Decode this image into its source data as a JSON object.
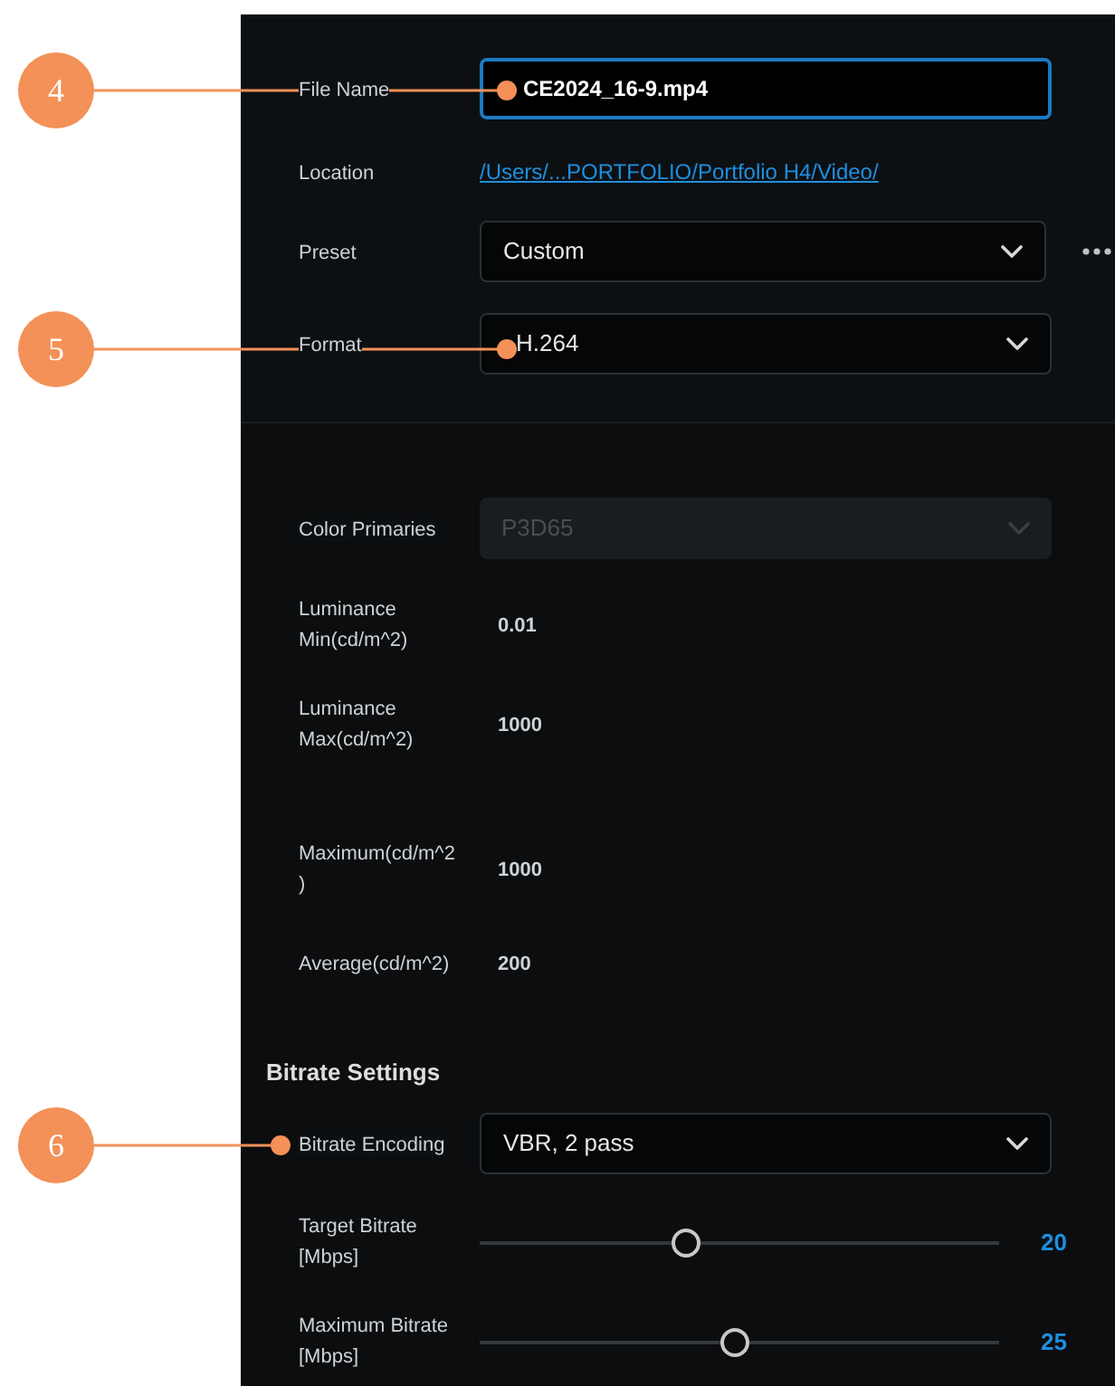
{
  "callouts": [
    {
      "number": "4"
    },
    {
      "number": "5"
    },
    {
      "number": "6"
    }
  ],
  "output": {
    "file_name": {
      "label": "File Name",
      "value": "CE2024_16-9.mp4",
      "focused": true
    },
    "location": {
      "label": "Location",
      "value": "/Users/...PORTFOLIO/Portfolio H4/Video/"
    },
    "preset": {
      "label": "Preset",
      "value": "Custom"
    },
    "format": {
      "label": "Format",
      "value": "H.264"
    }
  },
  "hdr": {
    "color_primaries": {
      "label": "Color Primaries",
      "value": "P3D65",
      "disabled": true
    },
    "rows": [
      {
        "label": "Luminance Min(cd/m^2)",
        "value": "0.01"
      },
      {
        "label": "Luminance Max(cd/m^2)",
        "value": "1000"
      },
      {
        "label": "Maximum(cd/m^2)",
        "value": "1000"
      },
      {
        "label": "Average(cd/m^2)",
        "value": "200"
      }
    ]
  },
  "bitrate": {
    "title": "Bitrate Settings",
    "encoding": {
      "label": "Bitrate Encoding",
      "value": "VBR, 2 pass"
    },
    "sliders": [
      {
        "label": "Target Bitrate [Mbps]",
        "level": 0.39,
        "reading": "20"
      },
      {
        "label": "Maximum Bitrate [Mbps]",
        "level": 0.49,
        "reading": "25"
      }
    ]
  }
}
